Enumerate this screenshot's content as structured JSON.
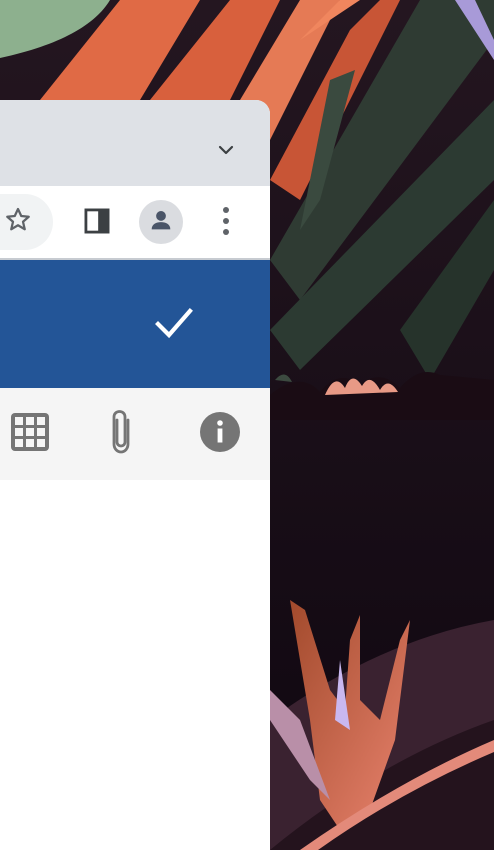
{
  "colors": {
    "tabstrip": "#dee1e6",
    "toolbar": "#ffffff",
    "omnibox": "#f1f3f4",
    "app_header": "#235597",
    "action_bar": "#f5f5f5",
    "icon_gray": "#5f6368",
    "action_icon_gray": "#757575"
  },
  "browser": {
    "tabstrip": {
      "tab_search_icon": "chevron-down-icon"
    },
    "toolbar": {
      "bookmark_icon": "star-icon",
      "side_panel_icon": "side-panel-icon",
      "profile_icon": "person-icon",
      "menu_icon": "vertical-dots-icon"
    }
  },
  "app": {
    "header": {
      "confirm_icon": "checkmark-icon"
    },
    "actions": [
      {
        "icon": "grid-icon"
      },
      {
        "icon": "paperclip-icon"
      },
      {
        "icon": "info-icon"
      }
    ]
  }
}
